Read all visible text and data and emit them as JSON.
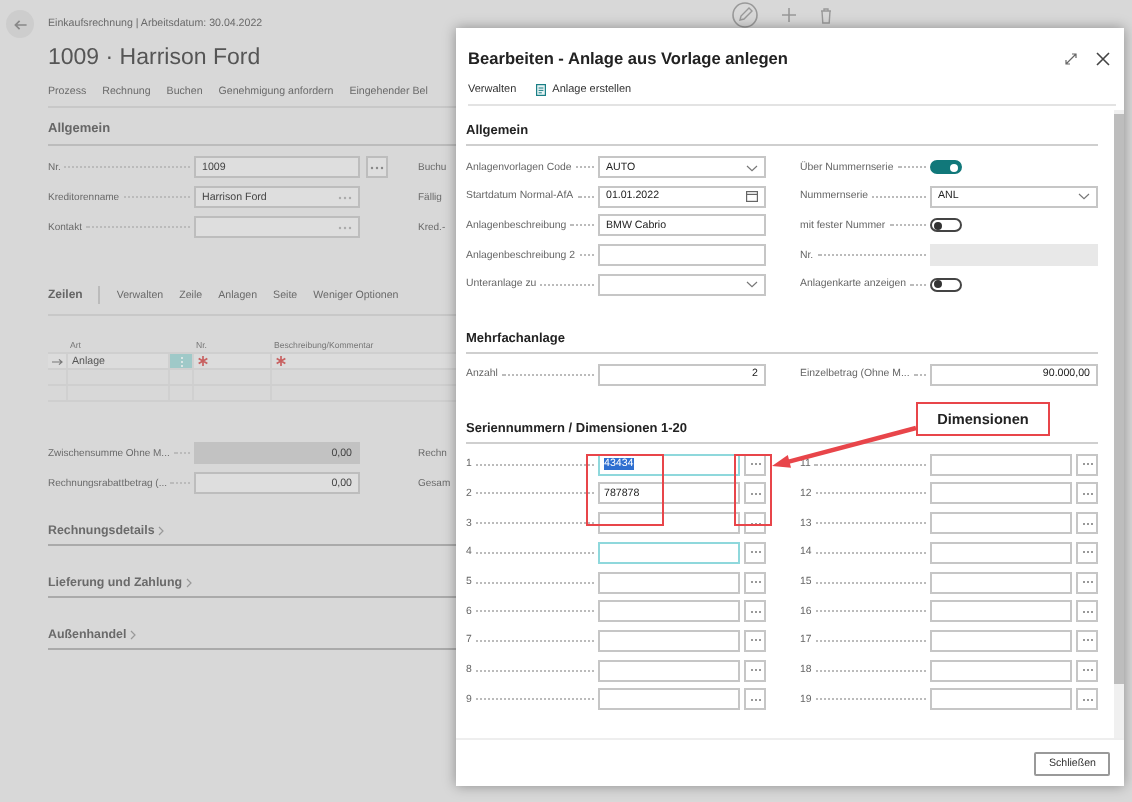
{
  "page": {
    "breadcrumb": "Einkaufsrechnung | Arbeitsdatum: 30.04.2022",
    "title": "1009 · Harrison Ford",
    "menu": [
      "Prozess",
      "Rechnung",
      "Buchen",
      "Genehmigung anfordern",
      "Eingehender Bel"
    ],
    "general": {
      "heading": "Allgemein",
      "fields": [
        {
          "label": "Nr.",
          "value": "1009",
          "kind": "lookup_button",
          "side_label": "Buchu"
        },
        {
          "label": "Kreditorenname",
          "value": "Harrison Ford",
          "kind": "lookup",
          "side_label": "Fällig"
        },
        {
          "label": "Kontakt",
          "kind": "lookup",
          "side_label": "Kred.-"
        }
      ]
    },
    "lines": {
      "heading": "Zeilen",
      "actions": [
        "Verwalten",
        "Zeile",
        "Anlagen",
        "Seite",
        "Weniger Optionen"
      ],
      "columns": [
        "Art",
        "Nr.",
        "Beschreibung/Kommentar"
      ],
      "rows": [
        {
          "art": "Anlage",
          "selected": true,
          "required": true
        },
        {
          "selected": false,
          "required": false
        },
        {
          "selected": false,
          "required": false
        }
      ]
    },
    "totals": [
      {
        "label": "Zwischensumme Ohne M...",
        "value": "0,00",
        "readonly": true,
        "side_label": "Rechn"
      },
      {
        "label": "Rechnungsrabattbetrag (...",
        "value": "0,00",
        "readonly": false,
        "side_label": "Gesam"
      }
    ],
    "sections": [
      "Rechnungsdetails",
      "Lieferung und Zahlung",
      "Außenhandel"
    ]
  },
  "dialog": {
    "title": "Bearbeiten - Anlage aus Vorlage anlegen",
    "actions": [
      {
        "label": "Verwalten",
        "kind": "menu"
      },
      {
        "label": "Anlage erstellen",
        "kind": "command"
      }
    ],
    "general": {
      "heading": "Allgemein",
      "left": [
        {
          "label": "Anlagenvorlagen Code",
          "kind": "dropdown",
          "value": "AUTO"
        },
        {
          "label": "Startdatum Normal-AfA",
          "kind": "date",
          "value": "01.01.2022"
        },
        {
          "label": "Anlagenbeschreibung",
          "kind": "text",
          "value": "BMW Cabrio",
          "disabled": false
        },
        {
          "label": "Anlagenbeschreibung 2",
          "kind": "text",
          "disabled": false
        },
        {
          "label": "Unteranlage zu",
          "kind": "dropdown"
        }
      ],
      "right": [
        {
          "label": "Über Nummernserie",
          "kind": "toggle",
          "on": true
        },
        {
          "label": "Nummernserie",
          "kind": "dropdown",
          "value": "ANL"
        },
        {
          "label": "mit fester Nummer",
          "kind": "toggle",
          "on": false
        },
        {
          "label": "Nr.",
          "kind": "text",
          "disabled": true
        },
        {
          "label": "Anlagenkarte anzeigen",
          "kind": "toggle",
          "on": false
        }
      ]
    },
    "multiple": {
      "heading": "Mehrfachanlage",
      "count_label": "Anzahl",
      "count": "2",
      "amount_label": "Einzelbetrag (Ohne M...",
      "amount": "90.000,00"
    },
    "series": {
      "heading": "Seriennummern / Dimensionen 1-20",
      "left": [
        {
          "label": "1",
          "value": "43434",
          "highlighted": true,
          "focused": true
        },
        {
          "label": "2",
          "value": "787878",
          "highlighted": false,
          "focused": false
        },
        {
          "label": "3",
          "focused": false
        },
        {
          "label": "4",
          "focused": true
        },
        {
          "label": "5",
          "focused": false
        },
        {
          "label": "6",
          "focused": false
        },
        {
          "label": "7",
          "focused": false
        },
        {
          "label": "8",
          "focused": false
        },
        {
          "label": "9",
          "focused": false
        }
      ],
      "right": [
        {
          "label": "11",
          "focused": false
        },
        {
          "label": "12",
          "focused": false
        },
        {
          "label": "13",
          "focused": false
        },
        {
          "label": "14",
          "focused": false
        },
        {
          "label": "15",
          "focused": false
        },
        {
          "label": "16",
          "focused": false
        },
        {
          "label": "17",
          "focused": false
        },
        {
          "label": "18",
          "focused": false
        },
        {
          "label": "19",
          "focused": false
        }
      ]
    },
    "close_button": "Schließen"
  },
  "annotation": {
    "callout": "Dimensionen"
  }
}
